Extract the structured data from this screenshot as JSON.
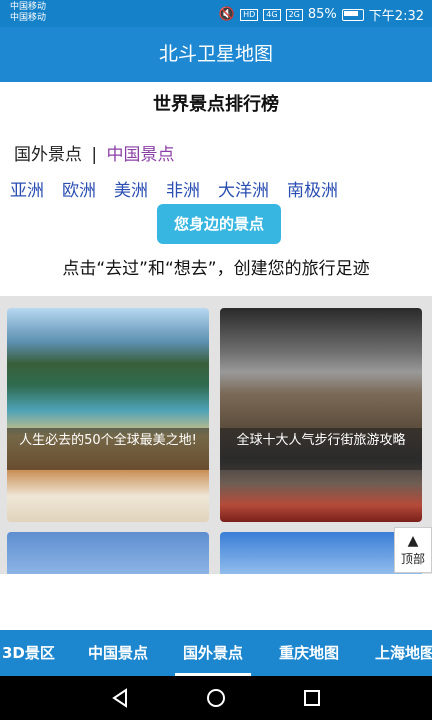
{
  "status_bar": {
    "carrier_1": "中国移动",
    "carrier_2": "中国移动",
    "hd_badge": "HD",
    "signal_1": "4G",
    "signal_2": "2G",
    "battery": "85%",
    "time": "下午2:32"
  },
  "app_title": "北斗卫星地图",
  "ranking": {
    "title": "世界景点排行榜",
    "scope_foreign": "国外景点",
    "scope_separator": "|",
    "scope_china": "中国景点",
    "continents": [
      "亚洲",
      "欧洲",
      "美洲",
      "非洲",
      "大洋洲",
      "南极洲"
    ],
    "nearby_button": "您身边的景点",
    "footprint_text": "点击“去过”和“想去”，创建您的旅行足迹"
  },
  "cards": [
    {
      "caption": "人生必去的50个全球最美之地!"
    },
    {
      "caption": "全球十大人气步行街旅游攻略"
    }
  ],
  "top_button": {
    "arrow": "▲",
    "label": "顶部"
  },
  "tabs": [
    "3D景区",
    "中国景点",
    "国外景点",
    "重庆地图",
    "上海地图"
  ],
  "active_tab": "国外景点",
  "colors": {
    "app_bar": "#1e88d2",
    "accent_button": "#36b6e0",
    "continent_link": "#2b4eb3",
    "china_link": "#8a3fa6"
  }
}
